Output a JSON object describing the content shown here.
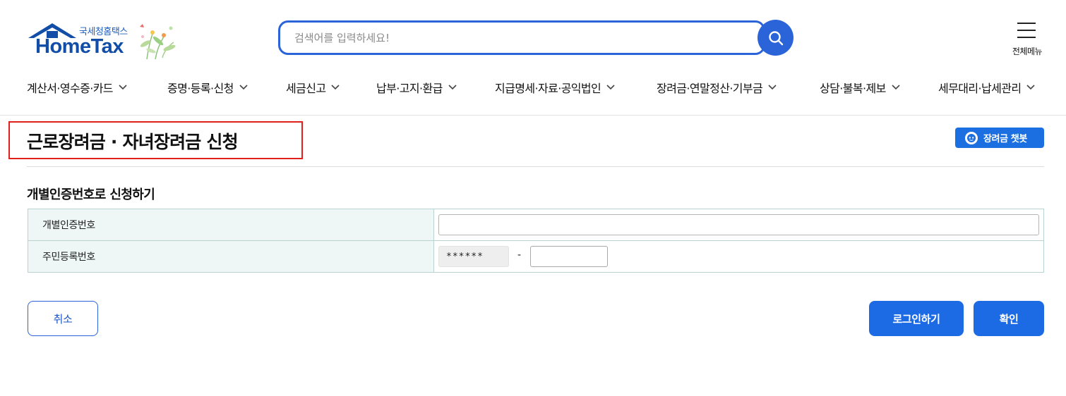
{
  "header": {
    "logo_sub": "국세청홈택스",
    "logo_main": "HomeTax",
    "search_placeholder": "검색어를 입력하세요!",
    "allmenu_label": "전체메뉴"
  },
  "gnb": [
    {
      "label": "계산서·영수증·카드"
    },
    {
      "label": "증명·등록·신청"
    },
    {
      "label": "세금신고"
    },
    {
      "label": "납부·고지·환급"
    },
    {
      "label": "지급명세·자료·공익법인"
    },
    {
      "label": "장려금·연말정산·기부금"
    },
    {
      "label": "상담·불복·제보"
    },
    {
      "label": "세무대리·납세관리"
    }
  ],
  "page": {
    "title": "근로장려금 · 자녀장려금 신청",
    "chatbot_label": "장려금 챗봇",
    "section_title": "개별인증번호로 신청하기"
  },
  "form": {
    "cert_label": "개별인증번호",
    "cert_value": "",
    "rrn_label": "주민등록번호",
    "rrn_front": "******",
    "rrn_dash": "-",
    "rrn_back_value": ""
  },
  "buttons": {
    "cancel": "취소",
    "login": "로그인하기",
    "confirm": "확인"
  },
  "colors": {
    "primary": "#1c6ae4",
    "search_border": "#2a64d8",
    "highlight_border": "#e0201c",
    "table_header_bg": "#eef7f6"
  }
}
